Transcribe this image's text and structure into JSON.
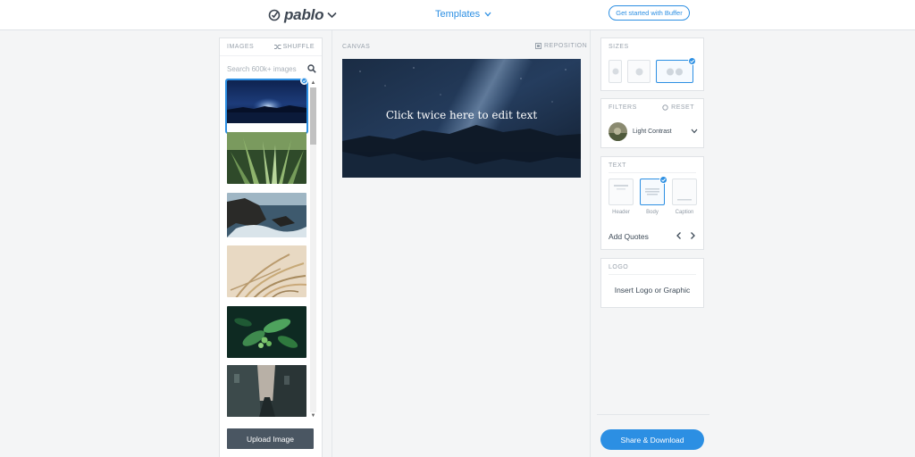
{
  "header": {
    "brand": "pablo",
    "templates_label": "Templates",
    "get_started_label": "Get started with Buffer"
  },
  "images_panel": {
    "title": "IMAGES",
    "shuffle_label": "SHUFFLE",
    "search_placeholder": "Search 600k+ images",
    "upload_label": "Upload Image",
    "thumbnails": [
      "night-sky-lake",
      "agave-plant",
      "rocky-coast",
      "dry-grass",
      "green-leaves",
      "narrow-street"
    ],
    "selected_index": 0
  },
  "canvas": {
    "label": "CANVAS",
    "reposition_label": "REPOSITION",
    "text": "Click twice here to edit text"
  },
  "sizes": {
    "title": "SIZES",
    "selected_index": 2
  },
  "filters": {
    "title": "FILTERS",
    "reset_label": "RESET",
    "current": "Light Contrast"
  },
  "text_panel": {
    "title": "TEXT",
    "options": [
      "Header",
      "Body",
      "Caption"
    ],
    "selected_index": 1,
    "add_quotes_label": "Add Quotes"
  },
  "logo": {
    "title": "LOGO",
    "insert_label": "Insert Logo or Graphic"
  },
  "share_label": "Share & Download",
  "colors": {
    "accent": "#2c8fe3",
    "dark_button": "#4a5662",
    "background": "#f4f5f6"
  },
  "icons": [
    "pablo-logo-icon",
    "chevron-down-icon",
    "shuffle-icon",
    "search-icon",
    "check-icon",
    "reposition-icon",
    "reset-icon",
    "chevron-left-icon",
    "chevron-right-icon"
  ]
}
